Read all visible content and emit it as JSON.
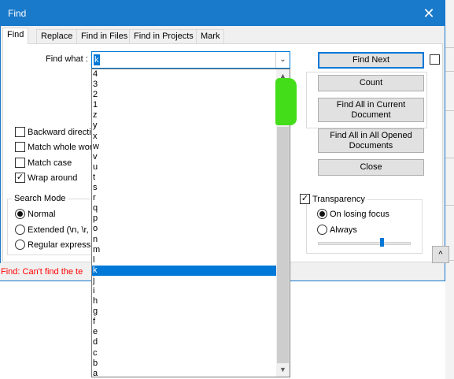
{
  "window": {
    "title": "Find",
    "close_glyph": "✕"
  },
  "tabs": [
    {
      "label": "Find"
    },
    {
      "label": "Replace"
    },
    {
      "label": "Find in Files"
    },
    {
      "label": "Find in Projects"
    },
    {
      "label": "Mark"
    }
  ],
  "find": {
    "label": "Find what :",
    "value": "k",
    "dropdown_arrow": "⌄"
  },
  "buttons": {
    "find_next": "Find Next",
    "count": "Count",
    "find_all_current": "Find All in Current Document",
    "find_all_opened": "Find All in All Opened Documents",
    "close": "Close",
    "collapse": "^"
  },
  "options": {
    "backward": {
      "label": "Backward directio",
      "checked": false
    },
    "whole_word": {
      "label": "Match whole wor",
      "checked": false
    },
    "match_case": {
      "label": "Match case",
      "checked": false
    },
    "wrap_around": {
      "label": "Wrap around",
      "checked": true
    }
  },
  "search_mode": {
    "title": "Search Mode",
    "normal": "Normal",
    "extended": "Extended (\\n, \\r,",
    "regex": "Regular expressi",
    "selected": "normal"
  },
  "transparency": {
    "label": "Transparency",
    "checked": true,
    "on_losing_focus": "On losing focus",
    "always": "Always",
    "selected": "on_losing_focus",
    "slider_level": 0.7
  },
  "status": {
    "text": "Find: Can't find the te"
  },
  "dropdown": {
    "selected_value": "k",
    "items": [
      "4",
      "3",
      "2",
      "1",
      "z",
      "y",
      "x",
      "w",
      "v",
      "u",
      "t",
      "s",
      "r",
      "q",
      "p",
      "o",
      "n",
      "m",
      "l",
      "k",
      "j",
      "i",
      "h",
      "g",
      "f",
      "e",
      "d",
      "c",
      "b",
      "a"
    ]
  },
  "colors": {
    "accent": "#1979ca",
    "selection": "#0078d7",
    "status_error": "#ff0000",
    "annotation_highlight": "#44dd1a"
  },
  "icons": {
    "close": "close-icon",
    "dropdown": "chevron-down-icon",
    "scroll_up": "chevron-up-icon",
    "scroll_down": "chevron-down-icon",
    "collapse": "chevron-up-icon"
  }
}
